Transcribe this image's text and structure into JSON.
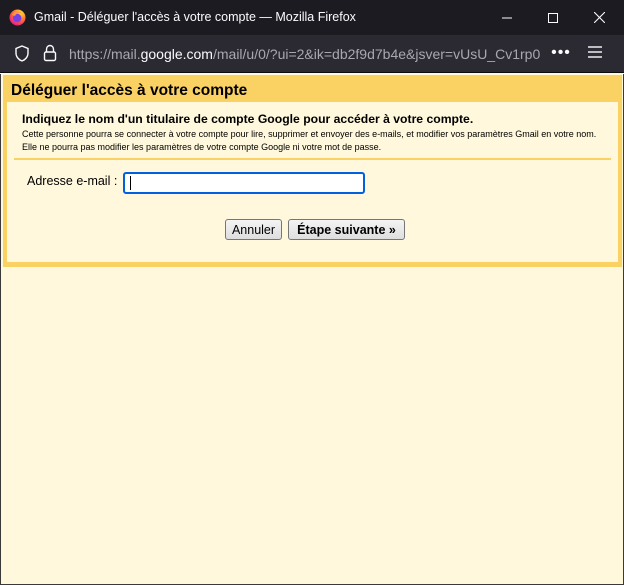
{
  "window": {
    "title": "Gmail - Déléguer l'accès à votre compte — Mozilla Firefox"
  },
  "urlbar": {
    "prefix": "https://mail.",
    "host": "google.com",
    "suffix": "/mail/u/0/?ui=2&ik=db2f9d7b4e&jsver=vUsU_Cv1rp0"
  },
  "dialog": {
    "title": "Déléguer l'accès à votre compte",
    "heading": "Indiquez le nom d'un titulaire de compte Google pour accéder à votre compte.",
    "description": "Cette personne pourra se connecter à votre compte pour lire, supprimer et envoyer des e-mails, et modifier vos paramètres Gmail en votre nom. Elle ne pourra pas modifier les paramètres de votre compte Google ni votre mot de passe.",
    "email_label": "Adresse e-mail :",
    "email_value": "",
    "cancel_label": "Annuler",
    "next_label": "Étape suivante »"
  },
  "colors": {
    "titlebar": "#1c1b22",
    "urlbar": "#2b2a33",
    "dialog_border": "#fad163",
    "page_background": "#fff8dc",
    "input_focus": "#0060df"
  },
  "icons": {
    "app": "firefox-icon",
    "minimize": "minimize-icon",
    "maximize": "maximize-icon",
    "close": "close-icon",
    "tracking": "shield-icon",
    "security": "lock-icon",
    "more": "more-dots-icon",
    "menu": "hamburger-menu-icon"
  }
}
